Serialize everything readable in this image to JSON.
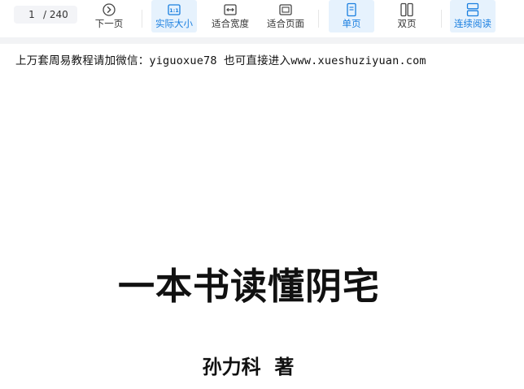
{
  "toolbar": {
    "page_current": "1",
    "page_total": "/ 240",
    "next_page": "下一页",
    "actual_size": "实际大小",
    "fit_width": "适合宽度",
    "fit_page": "适合页面",
    "single_page": "单页",
    "double_page": "双页",
    "continuous_read": "连续阅读"
  },
  "document": {
    "notice": "上万套周易教程请加微信：yiguoxue78  也可直接进入www.xueshuziyuan.com",
    "title": "一本书读懂阴宅",
    "author": "孙力科  著"
  },
  "colors": {
    "accent": "#1a7fe0",
    "active_bg": "#e6f2fd",
    "gutter": "#f2f3f5"
  },
  "icons": {
    "next_page": "circle-chevron-right-icon",
    "actual_size": "one-to-one-icon",
    "fit_width": "horizontal-arrows-icon",
    "fit_page": "page-frame-icon",
    "single_page": "single-page-icon",
    "double_page": "two-columns-icon",
    "continuous_read": "stacked-pages-icon"
  }
}
